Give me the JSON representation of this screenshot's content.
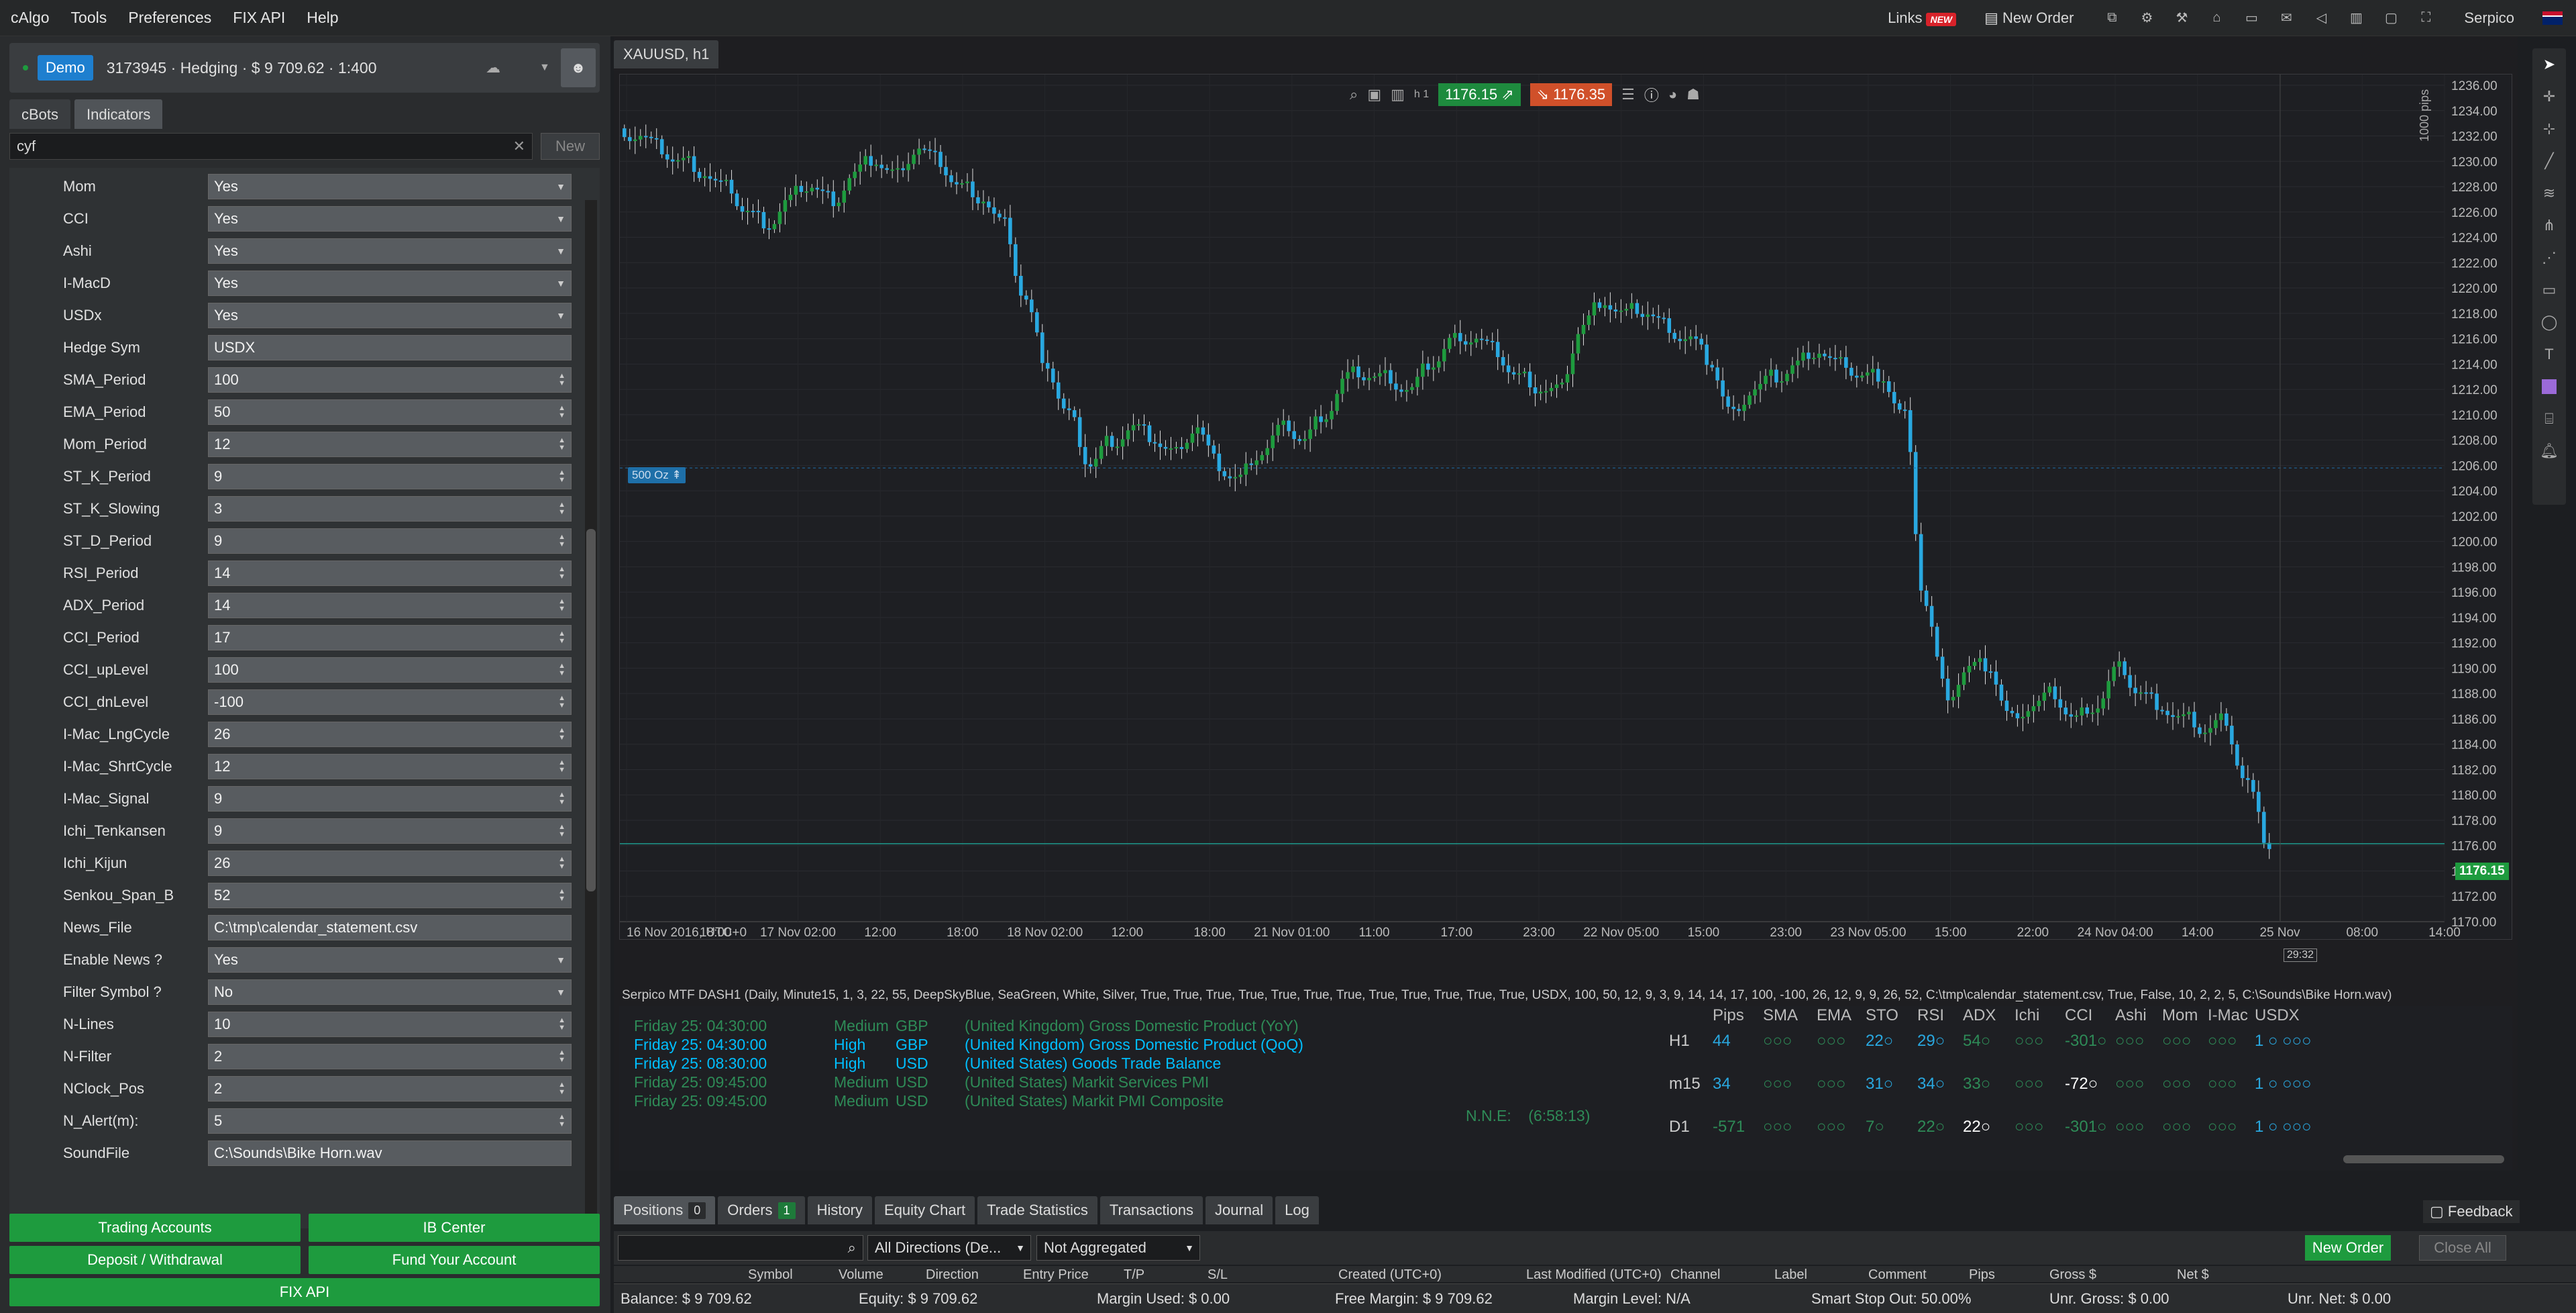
{
  "menu": {
    "items": [
      "cAlgo",
      "Tools",
      "Preferences",
      "FIX API",
      "Help"
    ],
    "links": "Links",
    "links_badge": "NEW",
    "new_order": "New Order",
    "user": "Serpico"
  },
  "account": {
    "mode": "Demo",
    "info": "3173945 · Hedging · $ 9 709.62 · 1:400"
  },
  "left_tabs": [
    "cBots",
    "Indicators"
  ],
  "search": {
    "value": "cyf",
    "new_label": "New"
  },
  "params": [
    {
      "label": "Mom",
      "value": "Yes",
      "type": "select"
    },
    {
      "label": "CCI",
      "value": "Yes",
      "type": "select"
    },
    {
      "label": "Ashi",
      "value": "Yes",
      "type": "select"
    },
    {
      "label": "I-MacD",
      "value": "Yes",
      "type": "select"
    },
    {
      "label": "USDx",
      "value": "Yes",
      "type": "select"
    },
    {
      "label": "Hedge Sym",
      "value": "USDX",
      "type": "text"
    },
    {
      "label": "SMA_Period",
      "value": "100",
      "type": "num"
    },
    {
      "label": "EMA_Period",
      "value": "50",
      "type": "num"
    },
    {
      "label": "Mom_Period",
      "value": "12",
      "type": "num"
    },
    {
      "label": "ST_K_Period",
      "value": "9",
      "type": "num"
    },
    {
      "label": "ST_K_Slowing",
      "value": "3",
      "type": "num"
    },
    {
      "label": "ST_D_Period",
      "value": "9",
      "type": "num"
    },
    {
      "label": "RSI_Period",
      "value": "14",
      "type": "num"
    },
    {
      "label": "ADX_Period",
      "value": "14",
      "type": "num"
    },
    {
      "label": "CCI_Period",
      "value": "17",
      "type": "num"
    },
    {
      "label": "CCI_upLevel",
      "value": "100",
      "type": "num"
    },
    {
      "label": "CCI_dnLevel",
      "value": "-100",
      "type": "num"
    },
    {
      "label": "I-Mac_LngCycle",
      "value": "26",
      "type": "num"
    },
    {
      "label": "I-Mac_ShrtCycle",
      "value": "12",
      "type": "num"
    },
    {
      "label": "I-Mac_Signal",
      "value": "9",
      "type": "num"
    },
    {
      "label": "Ichi_Tenkansen",
      "value": "9",
      "type": "num"
    },
    {
      "label": "Ichi_Kijun",
      "value": "26",
      "type": "num"
    },
    {
      "label": "Senkou_Span_B",
      "value": "52",
      "type": "num"
    },
    {
      "label": "News_File",
      "value": "C:\\tmp\\calendar_statement.csv",
      "type": "text"
    },
    {
      "label": "Enable News ?",
      "value": "Yes",
      "type": "select"
    },
    {
      "label": "Filter Symbol ?",
      "value": "No",
      "type": "select"
    },
    {
      "label": "N-Lines",
      "value": "10",
      "type": "num"
    },
    {
      "label": "N-Filter",
      "value": "2",
      "type": "num"
    },
    {
      "label": "NClock_Pos",
      "value": "2",
      "type": "num"
    },
    {
      "label": "N_Alert(m):",
      "value": "5",
      "type": "num"
    },
    {
      "label": "SoundFile",
      "value": "C:\\Sounds\\Bike Horn.wav",
      "type": "text"
    }
  ],
  "left_buttons": {
    "trading_accounts": "Trading Accounts",
    "ib_center": "IB Center",
    "deposit": "Deposit / Withdrawal",
    "fund": "Fund Your Account",
    "fix_api": "FIX API"
  },
  "chart": {
    "tab": "XAUUSD, h1",
    "bid": "1176.15",
    "ask": "1176.35",
    "current_price_label": "1176.15",
    "volume_label": "500 Oz",
    "pips_label": "1000 pips",
    "countdown": "29:32",
    "y_ticks": [
      "1236.00",
      "1234.00",
      "1232.00",
      "1230.00",
      "1228.00",
      "1226.00",
      "1224.00",
      "1222.00",
      "1220.00",
      "1218.00",
      "1216.00",
      "1214.00",
      "1212.00",
      "1210.00",
      "1208.00",
      "1206.00",
      "1204.00",
      "1202.00",
      "1200.00",
      "1198.00",
      "1196.00",
      "1194.00",
      "1192.00",
      "1190.00",
      "1188.00",
      "1186.00",
      "1184.00",
      "1182.00",
      "1180.00",
      "1178.00",
      "1176.00",
      "1174.00",
      "1172.00",
      "1170.00"
    ],
    "x_ticks": [
      "16 Nov 2016, UTC+0",
      "18:00",
      "17 Nov 02:00",
      "12:00",
      "18:00",
      "18 Nov 02:00",
      "12:00",
      "18:00",
      "21 Nov 01:00",
      "11:00",
      "17:00",
      "23:00",
      "22 Nov 05:00",
      "15:00",
      "23:00",
      "23 Nov 05:00",
      "15:00",
      "22:00",
      "24 Nov 04:00",
      "14:00",
      "25 Nov",
      "08:00",
      "14:00"
    ]
  },
  "chart_data": {
    "type": "candlestick",
    "symbol": "XAUUSD",
    "timeframe": "h1",
    "ylim": [
      1170,
      1236
    ],
    "series": [
      {
        "values": [
          1232,
          1231,
          1230,
          1229,
          1228,
          1226,
          1225,
          1227,
          1228,
          1227,
          1229,
          1230,
          1229,
          1231,
          1230,
          1228,
          1227,
          1225,
          1219,
          1214,
          1210,
          1206,
          1208,
          1209,
          1208,
          1207,
          1209,
          1206,
          1205,
          1207,
          1209,
          1208,
          1210,
          1213,
          1213,
          1213,
          1212,
          1214,
          1216,
          1216,
          1215,
          1213,
          1212,
          1212,
          1217,
          1219,
          1218,
          1218,
          1217,
          1216,
          1214,
          1210,
          1212,
          1213,
          1214,
          1215,
          1214,
          1213,
          1213,
          1210,
          1195,
          1188,
          1190,
          1190,
          1186,
          1187,
          1188,
          1186,
          1187,
          1190,
          1188,
          1187,
          1186,
          1185,
          1186,
          1181,
          1176
        ]
      }
    ],
    "current_price": 1176.15
  },
  "indicator_header": "Serpico MTF DASH1 (Daily, Minute15, 1, 3, 22, 55, DeepSkyBlue, SeaGreen, White, Silver, True, True, True, True, True, True, True, True, True, True, True, True, USDX, 100, 50, 12, 9, 3, 9, 14, 14, 17, 100, -100, 26, 12, 9, 9, 26, 52, C:\\tmp\\calendar_statement.csv, True, False, 10, 2, 2, 5, C:\\Sounds\\Bike Horn.wav)",
  "news": [
    {
      "time": "Friday 25: 04:30:00",
      "impact": "Medium",
      "cur": "GBP",
      "event": "(United Kingdom) Gross Domestic Product (YoY)",
      "color": "#2e8b57"
    },
    {
      "time": "Friday 25: 04:30:00",
      "impact": "High",
      "cur": "GBP",
      "event": "(United Kingdom) Gross Domestic Product (QoQ)",
      "color": "#00bfff"
    },
    {
      "time": "Friday 25: 08:30:00",
      "impact": "High",
      "cur": "USD",
      "event": "(United States) Goods Trade Balance",
      "color": "#00bfff"
    },
    {
      "time": "Friday 25: 09:45:00",
      "impact": "Medium",
      "cur": "USD",
      "event": "(United States) Markit Services PMI",
      "color": "#2e8b57"
    },
    {
      "time": "Friday 25: 09:45:00",
      "impact": "Medium",
      "cur": "USD",
      "event": "(United States) Markit PMI Composite",
      "color": "#2e8b57"
    }
  ],
  "nne": {
    "label": "N.N.E:",
    "value": "(6:58:13)"
  },
  "mtf": {
    "headers": [
      "Pips",
      "SMA",
      "EMA",
      "STO",
      "RSI",
      "ADX",
      "Ichi",
      "CCI",
      "Ashi",
      "Mom",
      "I-Mac",
      "USDX"
    ],
    "rows": [
      {
        "tf": "H1",
        "cells": [
          "44",
          "○○○",
          "○○○",
          "22○",
          "29○",
          "54○",
          "○○○",
          "-301○",
          "○○○",
          "○○○",
          "○○○",
          "1 ○ ○○○"
        ]
      },
      {
        "tf": "m15",
        "cells": [
          "34",
          "○○○",
          "○○○",
          "31○",
          "34○",
          "33○",
          "○○○",
          "-72○",
          "○○○",
          "○○○",
          "○○○",
          "1 ○ ○○○"
        ]
      },
      {
        "tf": "D1",
        "cells": [
          "-571",
          "○○○",
          "○○○",
          "7○",
          "22○",
          "22○",
          "○○○",
          "-301○",
          "○○○",
          "○○○",
          "○○○",
          "1 ○ ○○○"
        ]
      }
    ]
  },
  "bottom_tabs": [
    {
      "label": "Positions",
      "count": "0"
    },
    {
      "label": "Orders",
      "count": "1"
    },
    {
      "label": "History"
    },
    {
      "label": "Equity Chart"
    },
    {
      "label": "Trade Statistics"
    },
    {
      "label": "Transactions"
    },
    {
      "label": "Journal"
    },
    {
      "label": "Log"
    }
  ],
  "feedback": "Feedback",
  "filters": {
    "direction": "All Directions (De...",
    "aggregation": "Not Aggregated",
    "new_order": "New Order",
    "close_all": "Close All"
  },
  "columns": [
    "Symbol",
    "Volume",
    "Direction",
    "Entry Price",
    "T/P",
    "S/L",
    "Created (UTC+0)",
    "Last Modified (UTC+0)",
    "Channel",
    "Label",
    "Comment",
    "Pips",
    "Gross $",
    "Net $"
  ],
  "status": {
    "balance": "Balance: $ 9 709.62",
    "equity": "Equity: $ 9 709.62",
    "margin_used": "Margin Used: $ 0.00",
    "free_margin": "Free Margin: $ 9 709.62",
    "margin_level": "Margin Level: N/A",
    "stop_out": "Smart Stop Out: 50.00%",
    "unr_gross": "Unr. Gross: $ 0.00",
    "unr_net": "Unr. Net: $ 0.00"
  },
  "colors": {
    "bull": "#1e9b3e",
    "bear": "#29a8e0",
    "bid": "#1e8b3e",
    "ask": "#d0502a"
  }
}
